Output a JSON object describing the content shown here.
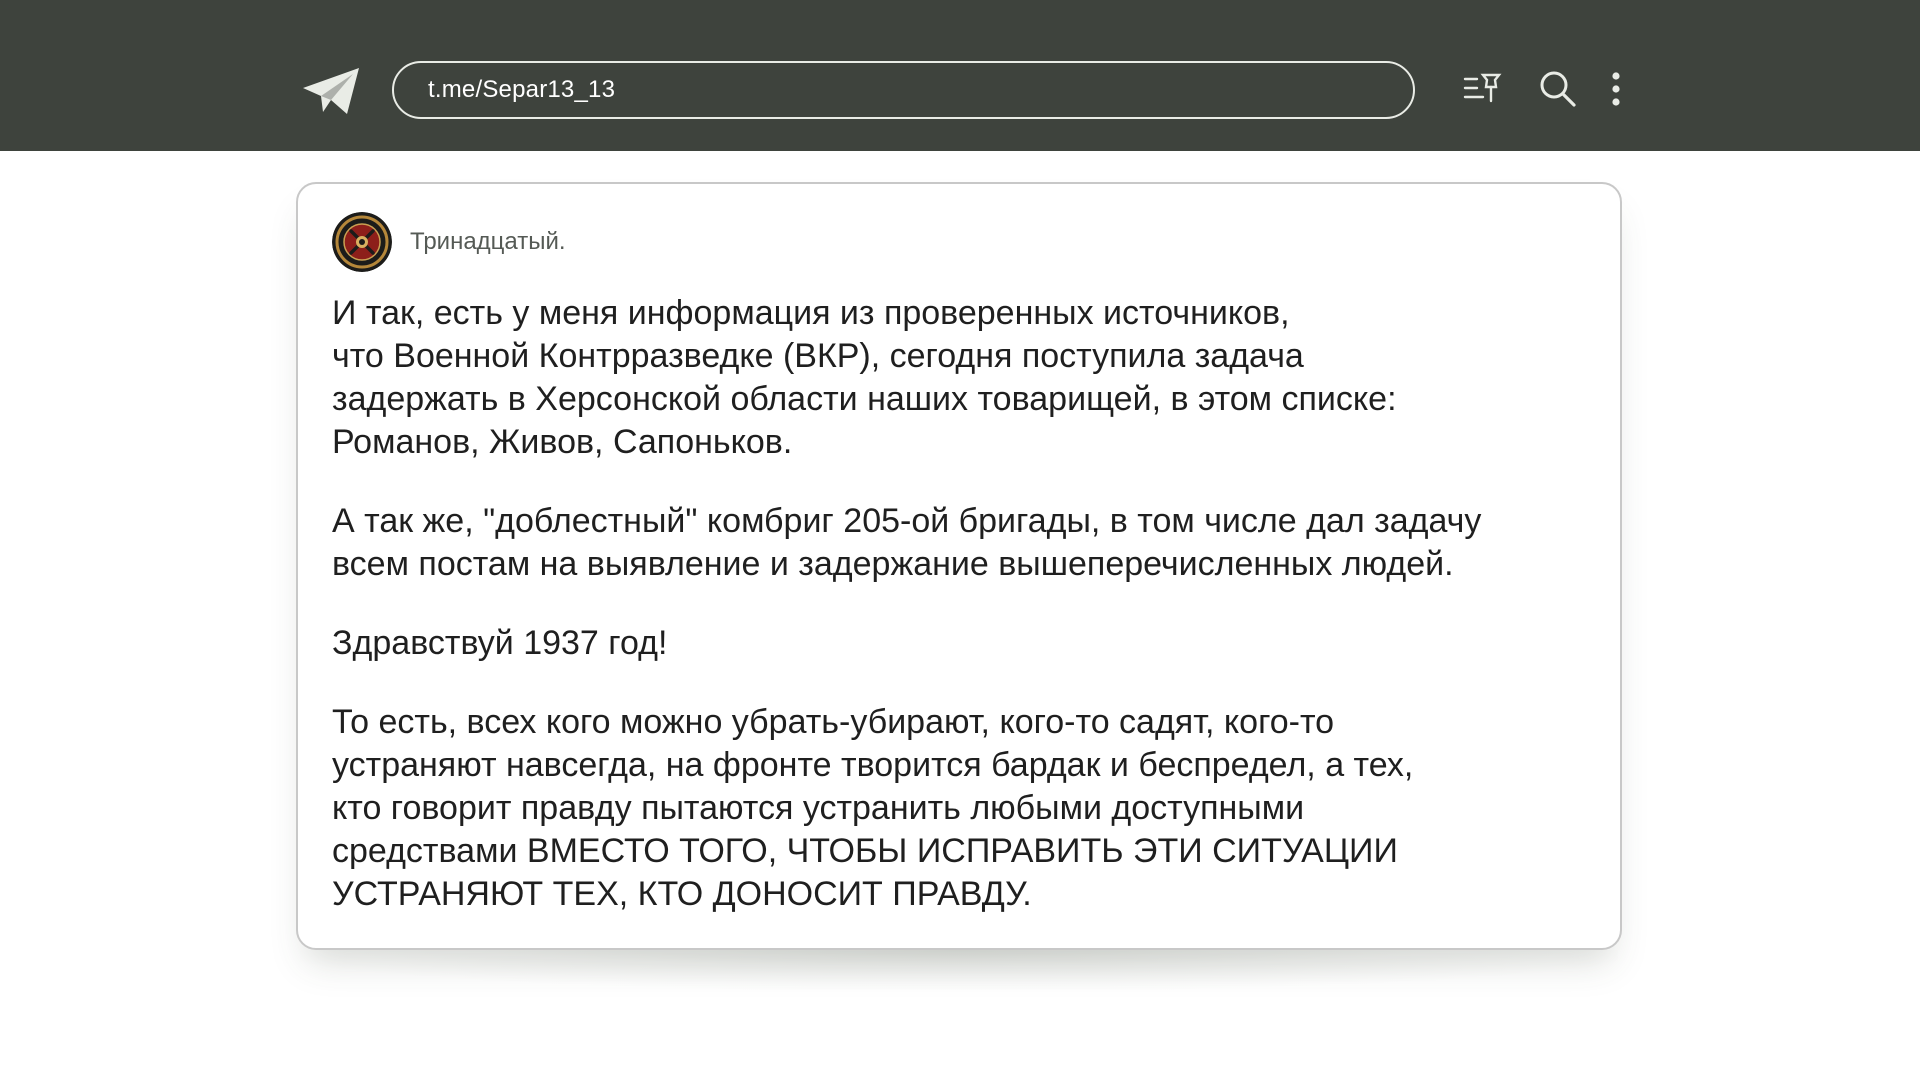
{
  "header": {
    "logo_icon": "telegram-plane-icon",
    "url": "t.me/Separ13_13",
    "actions": [
      {
        "icon": "pinned-list-icon"
      },
      {
        "icon": "search-icon"
      },
      {
        "icon": "more-vertical-icon"
      }
    ],
    "bg_color": "#3e433d"
  },
  "post": {
    "channel_name": "Тринадцатый.",
    "avatar_icon": "wagner-emblem-icon",
    "paragraphs": [
      "И так, есть у меня информация из проверенных источников,\nчто Военной Контрразведке (ВКР), сегодня поступила задача\nзадержать в Херсонской области наших товарищей, в этом списке:\nРоманов, Живов, Сапоньков.",
      "А так же, \"доблестный\" комбриг 205-ой бригады, в том числе дал задачу\nвсем постам на выявление и задержание вышеперечисленных людей.",
      "Здравствуй 1937 год!",
      "То есть, всех кого можно убрать-убирают, кого-то садят, кого-то\nустраняют навсегда, на фронте творится бардак и беспредел, а тех,\nкто говорит правду пытаются устранить любыми доступными\nсредствами ВМЕСТО ТОГО, ЧТОБЫ ИСПРАВИТЬ ЭТИ СИТУАЦИИ\nУСТРАНЯЮТ ТЕХ, КТО ДОНОСИТ ПРАВДУ."
    ]
  }
}
